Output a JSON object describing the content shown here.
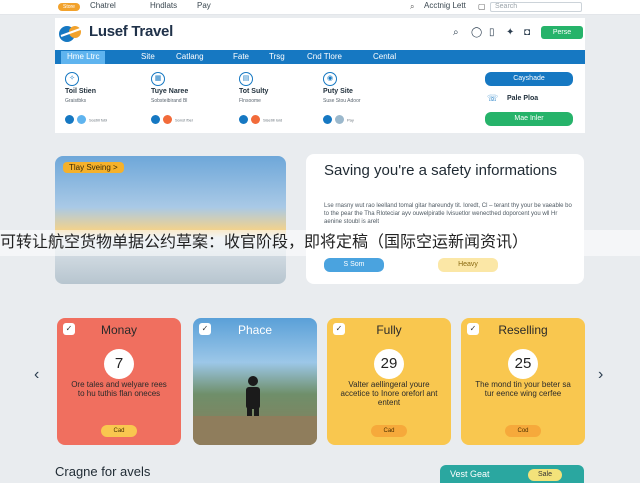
{
  "topbar": {
    "badge": "Store",
    "links": [
      "Chatrel",
      "Hndlats",
      "Pay"
    ],
    "right_link": "Acctnig Lett",
    "search_placeholder": "Search"
  },
  "header": {
    "logo_text": "Lusef Travel",
    "cta_label": "Perse",
    "nav": [
      "Hme Ltrc",
      "Site",
      "Catlang",
      "Fate",
      "Trsg",
      "Cnd Tlore",
      "Cental"
    ],
    "features": [
      {
        "title": "Toil Stien",
        "sub": "Graistbks",
        "tiny": "Sostill fobl"
      },
      {
        "title": "Tuye Naree",
        "sub": "Sobsteibirand Bl",
        "tiny": "Sonst fbel"
      },
      {
        "title": "Tot Sulty",
        "sub": "Flnsoome",
        "tiny": "Sisetill Ioid"
      },
      {
        "title": "Puty Site",
        "sub": "Suse Stou Adoor",
        "tiny": "Pay"
      }
    ],
    "side_actions": [
      "Cayshade",
      "Pale Ploa",
      "Mae Inler"
    ]
  },
  "promo": {
    "tag": "Tlay Sveing >",
    "title": "Saving you're a safety informations",
    "body": "Lse rnasny wut rao leelland tomal gitar hareundy tit. Ioredt, Cl – terant thy your be vaeable bo to the pear the Tha Rloteciar ayv ouwelpiratle Ivisuetlor wenecthed doporcent you wll Hr aenine stoubl is arelt",
    "btn_blue": "S Som",
    "btn_yellow": "Heavy"
  },
  "overlay_caption": "可转让航空货物单据公约草案：收官阶段，即将定稿（国际空运新闻资讯）",
  "cards": [
    {
      "title": "Monay",
      "number": "7",
      "body": "Ore tales and welyare rees to hu tuthis flan oneces",
      "button": "Cad"
    },
    {
      "title": "Phace",
      "number": "",
      "body": "",
      "button": ""
    },
    {
      "title": "Fully",
      "number": "29",
      "body": "Valter aellingeral youre accetice to Inore oreforl ant entent",
      "button": "Cad"
    },
    {
      "title": "Reselling",
      "number": "25",
      "body": "The mond tin your beter sa tur eence wing cerfee",
      "button": "Cod"
    }
  ],
  "bottom": {
    "title": "Cragne for avels",
    "panel_text": "Vest Geat",
    "panel_pill": "Sale"
  },
  "colors": {
    "primary_blue": "#1678c2",
    "accent_green": "#26b36a",
    "card_red": "#f06f5f",
    "card_yellow": "#f9c74f",
    "teal": "#2aa7a0"
  }
}
